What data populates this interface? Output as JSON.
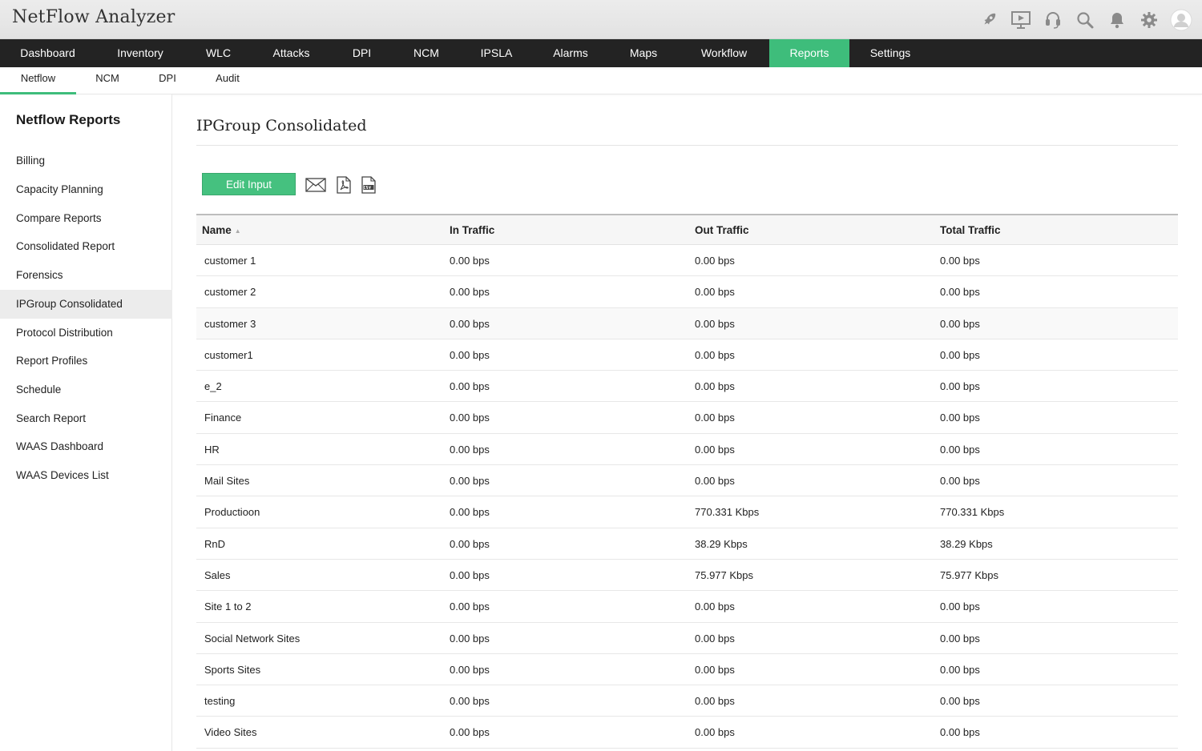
{
  "app": {
    "title": "NetFlow Analyzer"
  },
  "header_icons": [
    "rocket-icon",
    "presentation-icon",
    "headset-icon",
    "search-icon",
    "bell-icon",
    "gear-icon",
    "user-avatar-icon"
  ],
  "main_nav": {
    "items": [
      {
        "label": "Dashboard"
      },
      {
        "label": "Inventory"
      },
      {
        "label": "WLC"
      },
      {
        "label": "Attacks"
      },
      {
        "label": "DPI"
      },
      {
        "label": "NCM"
      },
      {
        "label": "IPSLA"
      },
      {
        "label": "Alarms"
      },
      {
        "label": "Maps"
      },
      {
        "label": "Workflow"
      },
      {
        "label": "Reports",
        "active": true
      },
      {
        "label": "Settings"
      }
    ]
  },
  "sub_nav": {
    "items": [
      {
        "label": "Netflow",
        "active": true
      },
      {
        "label": "NCM"
      },
      {
        "label": "DPI"
      },
      {
        "label": "Audit"
      }
    ]
  },
  "sidebar": {
    "title": "Netflow Reports",
    "items": [
      {
        "label": "Billing"
      },
      {
        "label": "Capacity Planning"
      },
      {
        "label": "Compare Reports"
      },
      {
        "label": "Consolidated Report"
      },
      {
        "label": "Forensics"
      },
      {
        "label": "IPGroup Consolidated",
        "active": true
      },
      {
        "label": "Protocol Distribution"
      },
      {
        "label": "Report Profiles"
      },
      {
        "label": "Schedule"
      },
      {
        "label": "Search Report"
      },
      {
        "label": "WAAS Dashboard"
      },
      {
        "label": "WAAS Devices List"
      }
    ]
  },
  "main": {
    "page_title": "IPGroup Consolidated",
    "edit_input_label": "Edit Input",
    "tool_icons": [
      "email-icon",
      "pdf-icon",
      "csv-icon"
    ],
    "table": {
      "columns": [
        "Name",
        "In Traffic",
        "Out Traffic",
        "Total Traffic"
      ],
      "rows": [
        [
          "customer 1",
          "0.00 bps",
          "0.00 bps",
          "0.00 bps"
        ],
        [
          "customer 2",
          "0.00 bps",
          "0.00 bps",
          "0.00 bps"
        ],
        [
          "customer 3",
          "0.00 bps",
          "0.00 bps",
          "0.00 bps"
        ],
        [
          "customer1",
          "0.00 bps",
          "0.00 bps",
          "0.00 bps"
        ],
        [
          "e_2",
          "0.00 bps",
          "0.00 bps",
          "0.00 bps"
        ],
        [
          "Finance",
          "0.00 bps",
          "0.00 bps",
          "0.00 bps"
        ],
        [
          "HR",
          "0.00 bps",
          "0.00 bps",
          "0.00 bps"
        ],
        [
          "Mail Sites",
          "0.00 bps",
          "0.00 bps",
          "0.00 bps"
        ],
        [
          "Productioon",
          "0.00 bps",
          "770.331 Kbps",
          "770.331 Kbps"
        ],
        [
          "RnD",
          "0.00 bps",
          "38.29 Kbps",
          "38.29 Kbps"
        ],
        [
          "Sales",
          "0.00 bps",
          "75.977 Kbps",
          "75.977 Kbps"
        ],
        [
          "Site 1 to 2",
          "0.00 bps",
          "0.00 bps",
          "0.00 bps"
        ],
        [
          "Social Network Sites",
          "0.00 bps",
          "0.00 bps",
          "0.00 bps"
        ],
        [
          "Sports Sites",
          "0.00 bps",
          "0.00 bps",
          "0.00 bps"
        ],
        [
          "testing",
          "0.00 bps",
          "0.00 bps",
          "0.00 bps"
        ],
        [
          "Video Sites",
          "0.00 bps",
          "0.00 bps",
          "0.00 bps"
        ]
      ]
    }
  },
  "colors": {
    "accent": "#3ebd7b",
    "nav_bg": "#232323",
    "header_bg": "#e6e6e6"
  }
}
